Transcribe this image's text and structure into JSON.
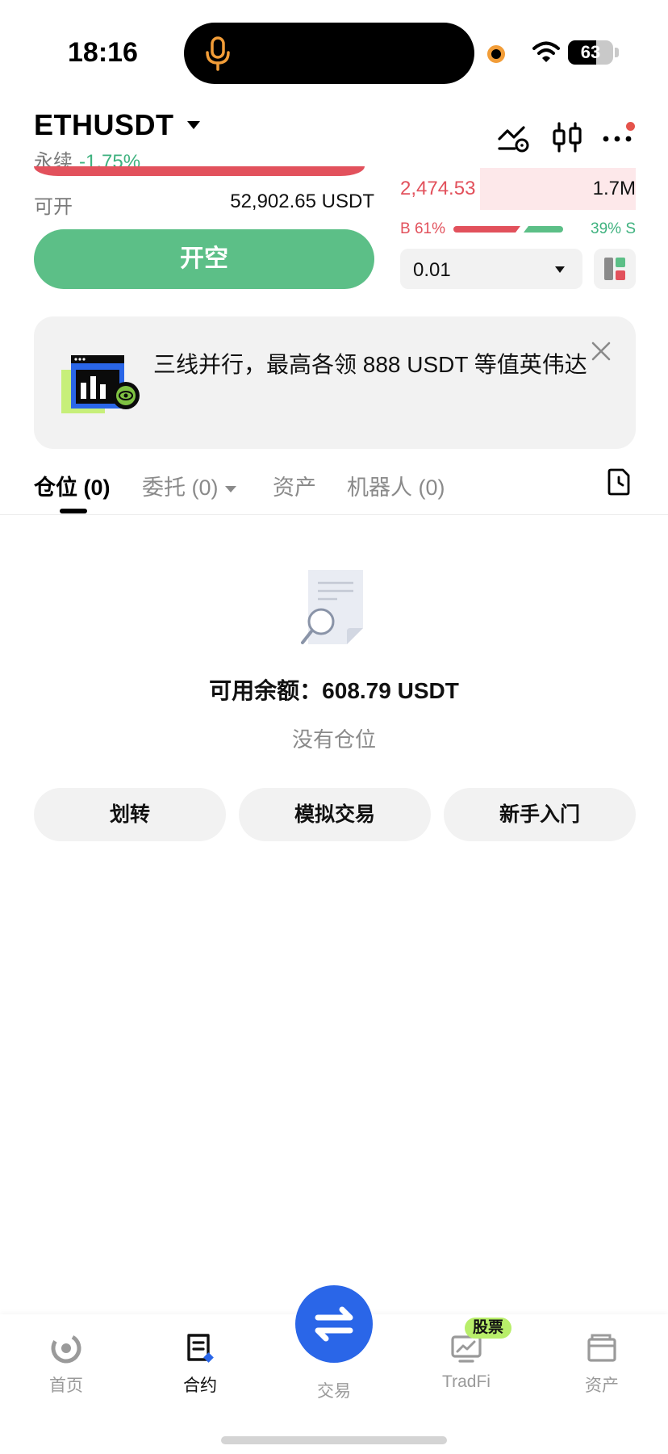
{
  "status_bar": {
    "time": "18:16",
    "battery": "63",
    "battery_level": 0.63
  },
  "header": {
    "pair": "ETHUSDT",
    "contract_type": "永续",
    "change": "-1.75%"
  },
  "trade": {
    "available_label": "可开",
    "available_value": "52,902.65 USDT",
    "short_button": "开空"
  },
  "orderbook": {
    "ask_price": "2,474.53",
    "ask_size": "1.7M",
    "ask_depth_fraction": 0.66,
    "buy_label": "B 61%",
    "sell_label": "39% S",
    "buy_ratio": 0.61,
    "sell_ratio": 0.39,
    "quantity": "0.01"
  },
  "banner": {
    "text": "三线并行，最高各领 888 USDT 等值英伟达"
  },
  "tabs": [
    {
      "label": "仓位 (0)"
    },
    {
      "label": "委托 (0)"
    },
    {
      "label": "资产"
    },
    {
      "label": "机器人 (0)"
    }
  ],
  "empty_state": {
    "balance": "可用余额：608.79 USDT",
    "message": "没有仓位"
  },
  "actions": [
    {
      "label": "划转"
    },
    {
      "label": "模拟交易"
    },
    {
      "label": "新手入门"
    }
  ],
  "bottom_nav": {
    "items": [
      {
        "label": "首页",
        "icon": "home-icon"
      },
      {
        "label": "合约",
        "icon": "contract-icon"
      },
      {
        "label": "交易",
        "icon": "swap-icon"
      },
      {
        "label": "TradFi",
        "icon": "tradfi-icon"
      },
      {
        "label": "资产",
        "icon": "wallet-icon"
      }
    ],
    "badge": "股票"
  },
  "colors": {
    "sell_red": "#e2515c",
    "buy_green": "#5cbf87",
    "accent_blue": "#2a66e8",
    "badge_green": "#b8ee6a"
  }
}
